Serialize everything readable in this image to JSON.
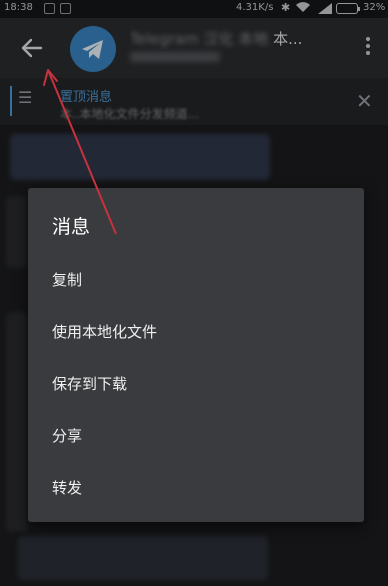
{
  "status_bar": {
    "time": "18:38",
    "net_speed": "4.31K/s",
    "battery": "32%"
  },
  "app_bar": {
    "title_suffix": "本..."
  },
  "pinned": {
    "label": "置顶消息",
    "text": "本..本地化文件分发频道..."
  },
  "popup": {
    "title": "消息",
    "items": [
      "复制",
      "使用本地化文件",
      "保存到下载",
      "分享",
      "转发"
    ]
  },
  "colors": {
    "accent": "#4e9bd6",
    "annotation_arrow": "#c8323c",
    "popup_bg": "#3a3b3e"
  }
}
